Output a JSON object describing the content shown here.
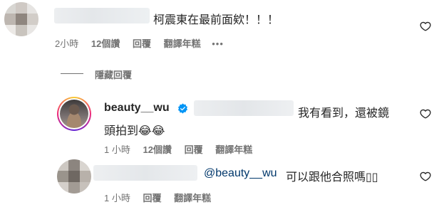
{
  "colors": {
    "text": "#262626",
    "meta": "#737373",
    "mention": "#00376b",
    "verified": "#0095f6"
  },
  "comment1": {
    "text": "柯震東在最前面欸！！！",
    "time": "2小時",
    "likes": "12個讚",
    "reply": "回覆",
    "translate": "翻譯年糕",
    "more": "•••"
  },
  "hide_replies": "隱藏回覆",
  "reply1": {
    "username": "beauty__wu",
    "text_line1": "我有看到，還被鏡",
    "text_line2": "頭拍到😂😂",
    "time": "1 小時",
    "likes": "12個讚",
    "reply": "回覆",
    "translate": "翻譯年糕"
  },
  "reply2": {
    "mention": "@beauty__wu",
    "text": "可以跟他合照嗎▯▯",
    "time": "1 小時",
    "reply": "回覆",
    "translate": "翻譯年糕"
  },
  "icons": [
    "heart-icon",
    "verified-badge-icon",
    "more-icon"
  ]
}
